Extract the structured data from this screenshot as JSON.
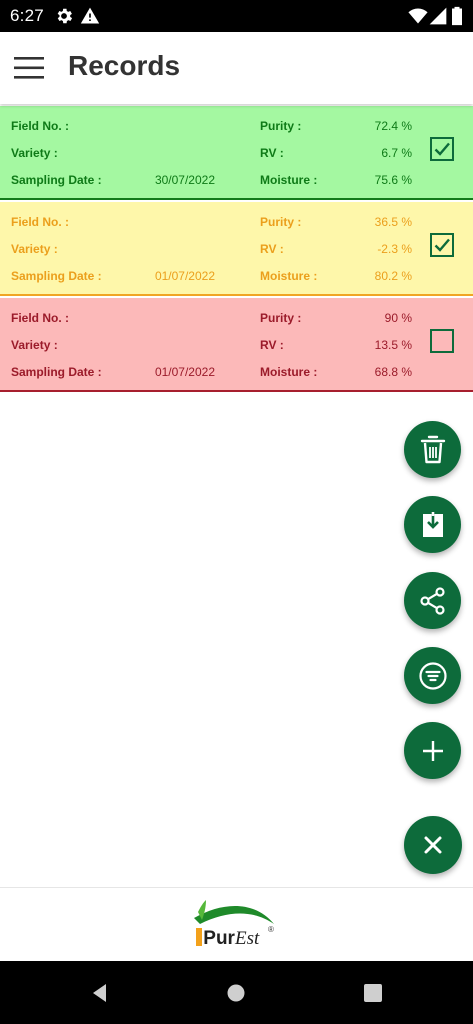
{
  "status_bar": {
    "time": "6:27",
    "icons": [
      "settings-icon",
      "alert-icon",
      "wifi-icon",
      "signal-icon",
      "battery-icon"
    ]
  },
  "app_bar": {
    "title": "Records",
    "menu_icon": "hamburger-menu-icon"
  },
  "labels": {
    "field_no": "Field No. :",
    "variety": "Variety :",
    "sampling_date": "Sampling Date :",
    "purity": "Purity :",
    "rv": "RV :",
    "moisture": "Moisture :"
  },
  "records": [
    {
      "status": "green",
      "color": "#0e7a17",
      "background": "#a4f8a1",
      "field_no": "",
      "variety": "",
      "sampling_date": "30/07/2022",
      "purity": "72.4 %",
      "rv": "6.7 %",
      "moisture": "75.6 %",
      "checked": true
    },
    {
      "status": "yellow",
      "color": "#eb9f1c",
      "background": "#fef7aa",
      "field_no": "",
      "variety": "",
      "sampling_date": "01/07/2022",
      "purity": "36.5 %",
      "rv": "-2.3 %",
      "moisture": "80.2 %",
      "checked": true
    },
    {
      "status": "red",
      "color": "#9b1b2a",
      "background": "#fcb9b9",
      "field_no": "",
      "variety": "",
      "sampling_date": "01/07/2022",
      "purity": "90 %",
      "rv": "13.5 %",
      "moisture": "68.8 %",
      "checked": false
    }
  ],
  "fabs": [
    "delete-icon",
    "download-icon",
    "share-icon",
    "filter-icon",
    "add-icon",
    "close-icon"
  ],
  "footer": {
    "logo_text_i": "i",
    "logo_text_pur": "Pur",
    "logo_text_est": "Est",
    "logo_reg": "®"
  },
  "nav_bar": [
    "back-icon",
    "home-icon",
    "recents-icon"
  ],
  "colors": {
    "accent": "#0d6b3b",
    "status_bar": "#000000",
    "title": "#333333"
  }
}
